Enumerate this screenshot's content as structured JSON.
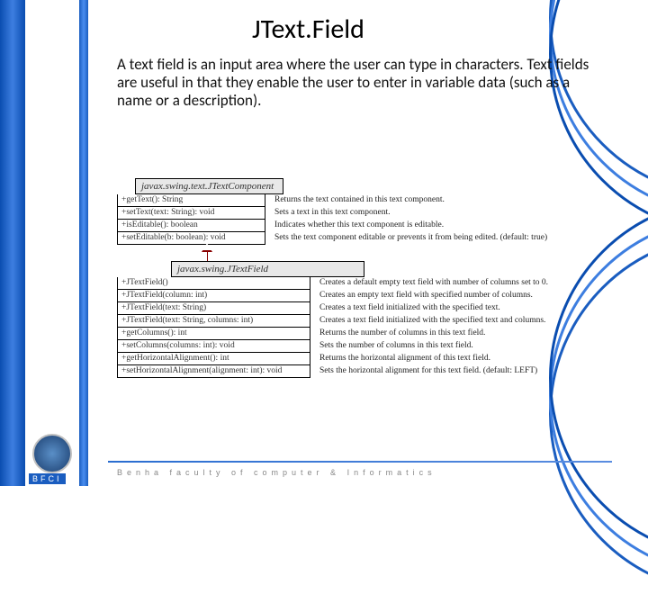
{
  "title": "JText.Field",
  "paragraph": "A text field is an input area where the user can type in characters. Text fields are useful in that they enable the user to enter in variable data (such as a name or a description).",
  "class1": {
    "name": "javax.swing.text.JTextComponent",
    "rows": [
      {
        "m": "+getText(): String",
        "d": "Returns the text contained in this text component."
      },
      {
        "m": "+setText(text: String): void",
        "d": "Sets a text in this text component."
      },
      {
        "m": "+isEditable(): boolean",
        "d": "Indicates whether this text component is editable."
      },
      {
        "m": "+setEditable(b: boolean): void",
        "d": "Sets the text component editable or prevents it from being edited. (default: true)"
      }
    ]
  },
  "class2": {
    "name": "javax.swing.JTextField",
    "rows": [
      {
        "m": "+JTextField()",
        "d": "Creates a default empty text field with number of columns set to 0."
      },
      {
        "m": "+JTextField(column: int)",
        "d": "Creates an empty text field with specified number of columns."
      },
      {
        "m": "+JTextField(text: String)",
        "d": "Creates a text field initialized with the specified text."
      },
      {
        "m": "+JTextField(text: String, columns: int)",
        "d": "Creates a text field initialized with the specified text and columns."
      },
      {
        "m": "+getColumns(): int",
        "d": "Returns the number of columns in this text field."
      },
      {
        "m": "+setColumns(columns: int): void",
        "d": "Sets the number of columns in this text field."
      },
      {
        "m": "+getHorizontalAlignment(): int",
        "d": "Returns the horizontal alignment of this text field."
      },
      {
        "m": "+setHorizontalAlignment(alignment: int): void",
        "d": "Sets the horizontal alignment for this text field. (default: LEFT)"
      }
    ]
  },
  "footer": {
    "org": "BFCI",
    "text": "Benha faculty of computer & Informatics"
  }
}
